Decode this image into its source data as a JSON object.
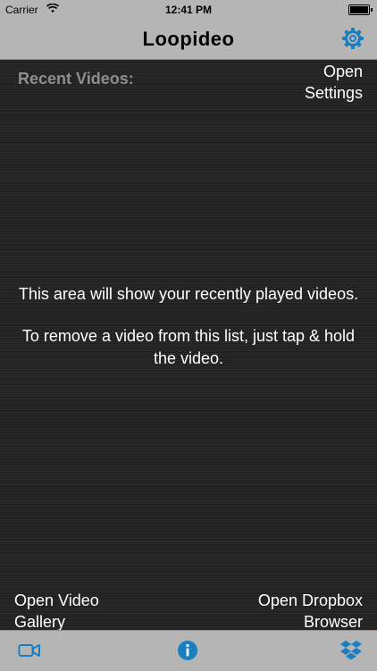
{
  "status_bar": {
    "carrier": "Carrier",
    "time": "12:41 PM",
    "battery_level": 1.0
  },
  "nav": {
    "title": "Loopideo",
    "settings_icon": "gear-icon"
  },
  "main": {
    "recent_label": "Recent Videos:",
    "open_settings": [
      "Open",
      "Settings"
    ],
    "info_lines": [
      "This area will show your recently played videos.",
      "To remove a video from this list, just tap & hold the video."
    ],
    "open_gallery": [
      "Open Video",
      "Gallery"
    ],
    "open_dropbox": [
      "Open Dropbox",
      "Browser"
    ]
  },
  "tab_bar": {
    "icons": [
      "video-camera-icon",
      "info-icon",
      "dropbox-icon"
    ]
  },
  "colors": {
    "accent": "#1a7fc0",
    "bar": "#b5b5b5",
    "background": "#232323",
    "muted_text": "#8d8d8d"
  }
}
